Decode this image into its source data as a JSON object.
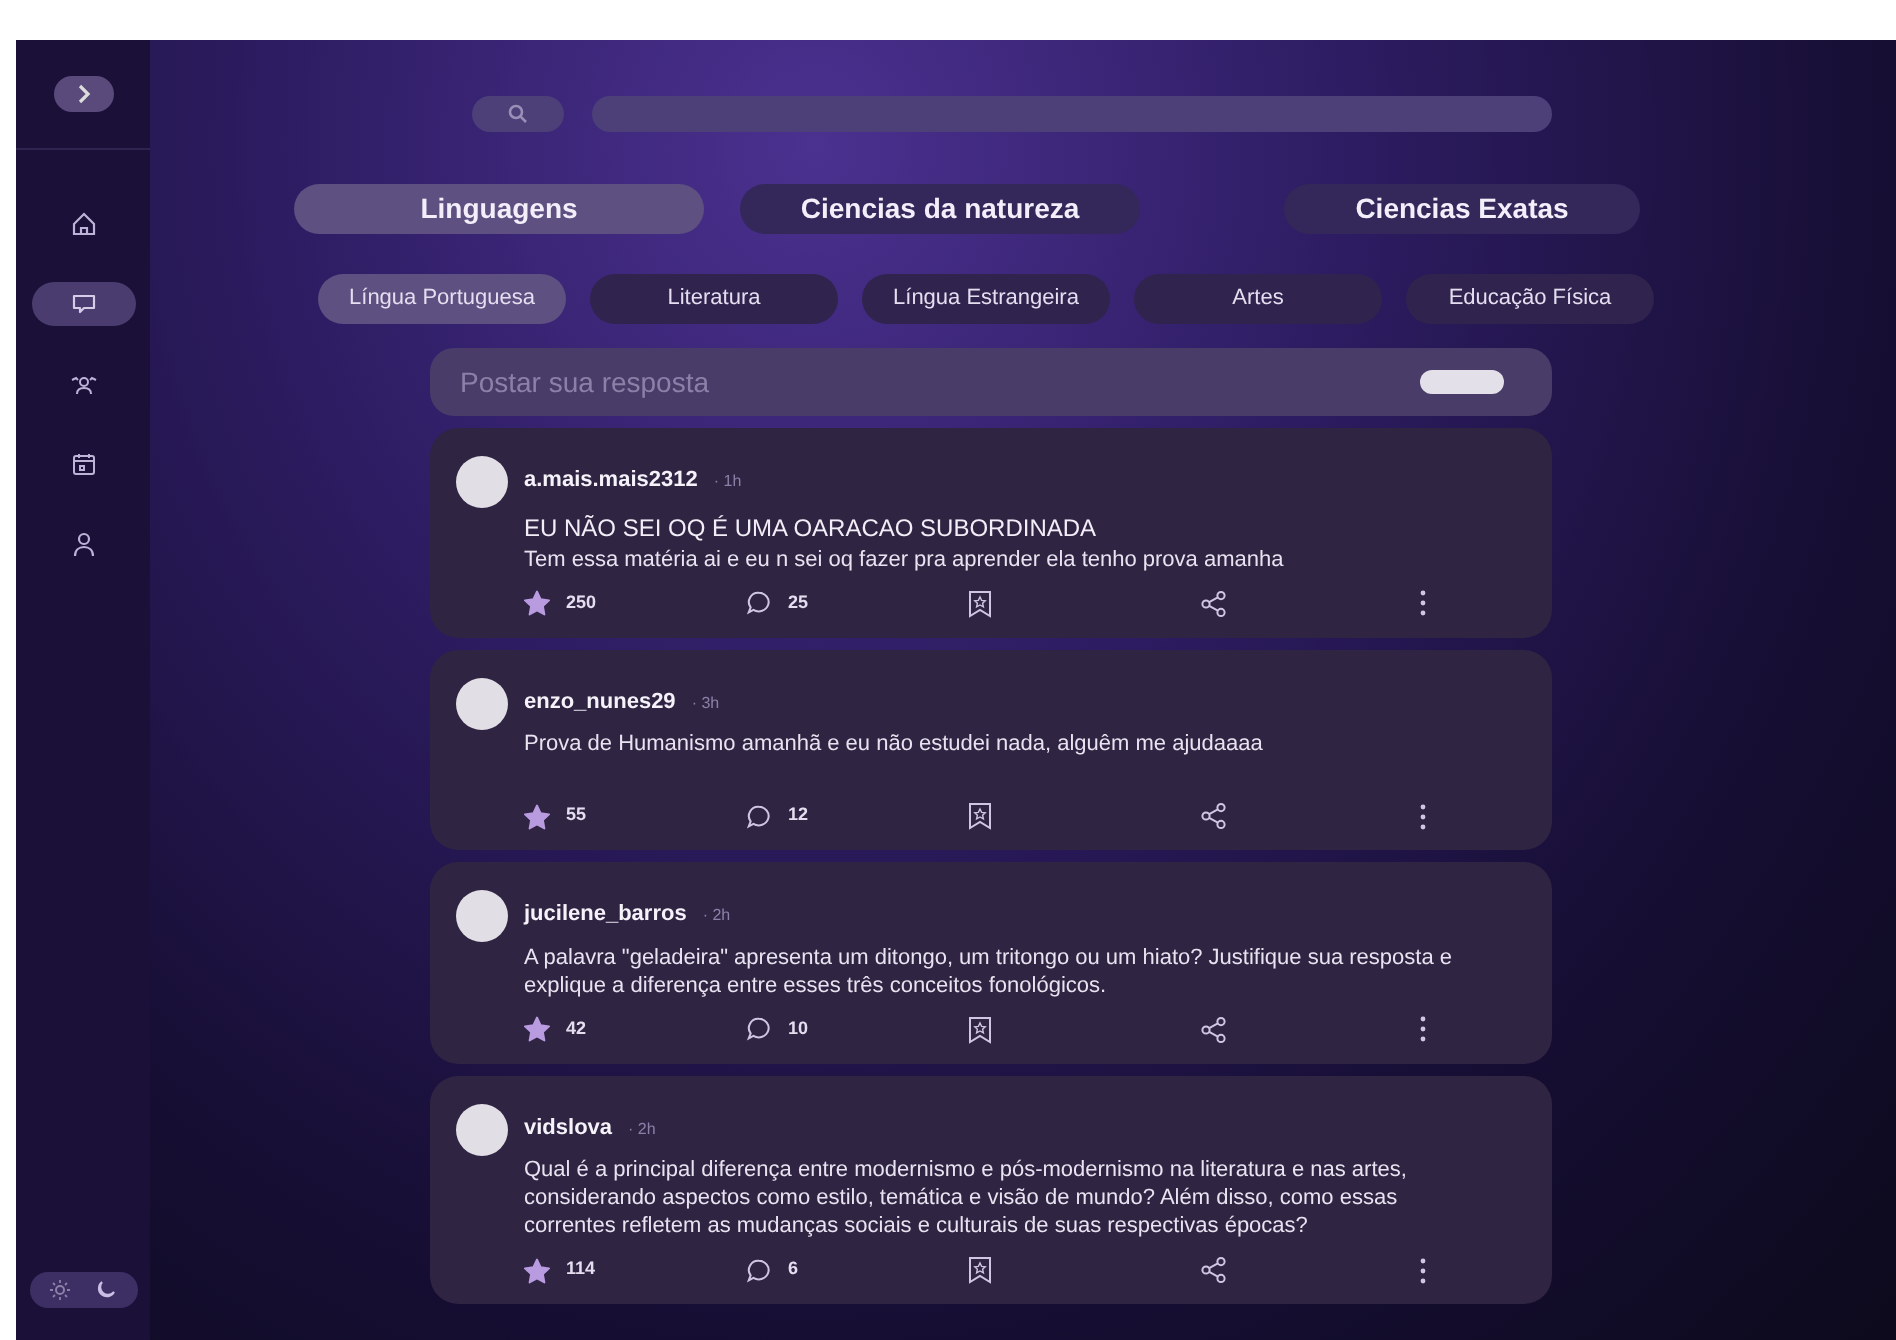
{
  "sidebar": {
    "items": [
      {
        "kind": "home",
        "selected": false
      },
      {
        "kind": "chat",
        "selected": true
      },
      {
        "kind": "group",
        "selected": false
      },
      {
        "kind": "calendar",
        "selected": false
      },
      {
        "kind": "person",
        "selected": false
      }
    ],
    "dark_mode": true
  },
  "categories": [
    {
      "label": "Linguagens",
      "selected": true
    },
    {
      "label": "Ciencias da natureza",
      "selected": false
    },
    {
      "label": "Ciencias Exatas",
      "selected": false
    }
  ],
  "subjects": [
    {
      "label": "Língua Portuguesa",
      "selected": true
    },
    {
      "label": "Literatura",
      "selected": false
    },
    {
      "label": "Língua Estrangeira",
      "selected": false
    },
    {
      "label": "Artes",
      "selected": false
    },
    {
      "label": "Educação Física",
      "selected": false
    }
  ],
  "composer": {
    "placeholder": "Postar sua resposta"
  },
  "posts": [
    {
      "user": "a.mais.mais2312",
      "time": "· 1h",
      "title": "EU NÃO SEI OQ É UMA OARACAO SUBORDINADA",
      "body": "Tem essa matéria ai e eu n sei oq fazer pra aprender ela tenho prova amanha",
      "stars": "250",
      "comments": "25"
    },
    {
      "user": "enzo_nunes29",
      "time": "· 3h",
      "body": "Prova de Humanismo amanhã e eu não estudei nada, alguêm me ajudaaaa",
      "stars": "55",
      "comments": "12"
    },
    {
      "user": "jucilene_barros",
      "time": "· 2h",
      "body": "A palavra \"geladeira\" apresenta um ditongo, um tritongo ou um hiato? Justifique sua resposta e explique a diferença entre esses três conceitos fonológicos.",
      "stars": "42",
      "comments": "10"
    },
    {
      "user": "vidslova",
      "time": "· 2h",
      "body": "Qual é a principal diferença entre modernismo e pós-modernismo na literatura e nas artes, considerando aspectos como estilo, temática e visão de mundo? Além disso, como essas correntes refletem as mudanças sociais e culturais de suas respectivas épocas?",
      "stars": "114",
      "comments": "6"
    }
  ]
}
